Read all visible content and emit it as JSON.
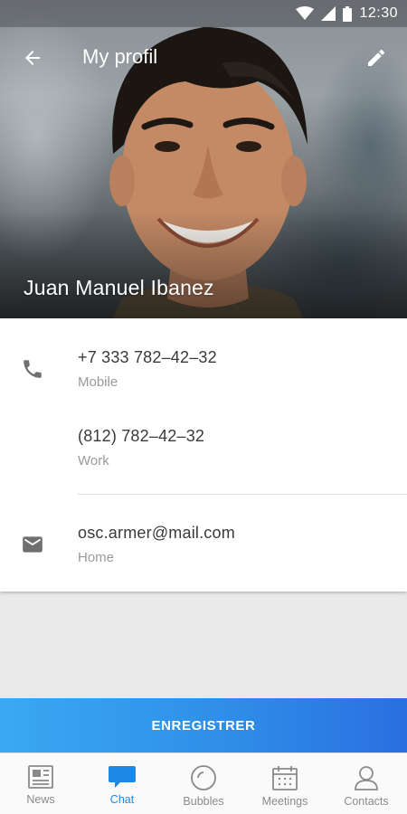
{
  "status_bar": {
    "time": "12:30"
  },
  "app_bar": {
    "title": "My profil"
  },
  "profile": {
    "name": "Juan Manuel Ibanez"
  },
  "contacts": {
    "phones": [
      {
        "value": "+7 333 782–42–32",
        "label": "Mobile"
      },
      {
        "value": "(812) 782–42–32",
        "label": "Work"
      }
    ],
    "emails": [
      {
        "value": "osc.armer@mail.com",
        "label": "Home"
      }
    ]
  },
  "save_button": {
    "label": "ENREGISTRER"
  },
  "bottom_nav": {
    "active": "Chat",
    "items": [
      {
        "label": "News",
        "icon": "news-icon"
      },
      {
        "label": "Chat",
        "icon": "chat-icon"
      },
      {
        "label": "Bubbles",
        "icon": "bubbles-icon"
      },
      {
        "label": "Meetings",
        "icon": "calendar-icon"
      },
      {
        "label": "Contacts",
        "icon": "person-icon"
      }
    ]
  },
  "colors": {
    "accent": "#1e88e5",
    "save_gradient_start": "#3aa9f2",
    "save_gradient_end": "#2a6fe0"
  }
}
